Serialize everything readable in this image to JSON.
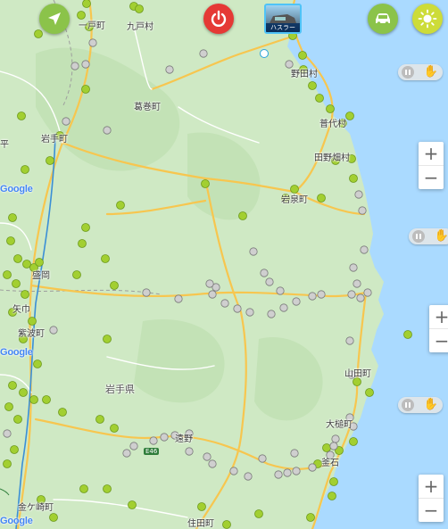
{
  "map": {
    "colors": {
      "land": "#cfe9c4",
      "sea": "#aadaff",
      "road_major": "#f7c64f",
      "road_minor": "#ffffff",
      "rail": "#3b8fd6",
      "marker_green": "#a2cf31",
      "marker_gray": "#cfcfcf"
    },
    "place_labels": [
      {
        "id": "ichinohe",
        "text": "一戸町"
      },
      {
        "id": "kunohe",
        "text": "九戸村"
      },
      {
        "id": "noda",
        "text": "野田村"
      },
      {
        "id": "kuzumaki",
        "text": "葛巻町"
      },
      {
        "id": "iwate",
        "text": "岩手町"
      },
      {
        "id": "fudai",
        "text": "普代村"
      },
      {
        "id": "tanohata",
        "text": "田野畑村"
      },
      {
        "id": "iwaizumi",
        "text": "岩泉町"
      },
      {
        "id": "morioka",
        "text": "盛岡"
      },
      {
        "id": "yahaba",
        "text": "矢巾"
      },
      {
        "id": "shiwa",
        "text": "紫波町"
      },
      {
        "id": "pref",
        "text": "岩手県"
      },
      {
        "id": "yamada",
        "text": "山田町"
      },
      {
        "id": "otsuchi",
        "text": "大槌町"
      },
      {
        "id": "tono",
        "text": "遠野"
      },
      {
        "id": "kamaishi",
        "text": "釜石"
      },
      {
        "id": "kanegasaki",
        "text": "金ケ崎町"
      },
      {
        "id": "sumita",
        "text": "住田町"
      },
      {
        "id": "hei",
        "text": "平"
      },
      {
        "id": "route",
        "text": "E46"
      }
    ],
    "watermarks": [
      "Google",
      "Google",
      "Google"
    ],
    "pins_highlight": 2
  },
  "controls": {
    "locate_icon": "navigation-arrow-icon",
    "power_icon": "power-icon",
    "car_icon": "car-icon",
    "sun_icon": "sun-icon",
    "thumbnail_caption": "ハスラー",
    "zoom_in": "+",
    "zoom_out": "−"
  }
}
